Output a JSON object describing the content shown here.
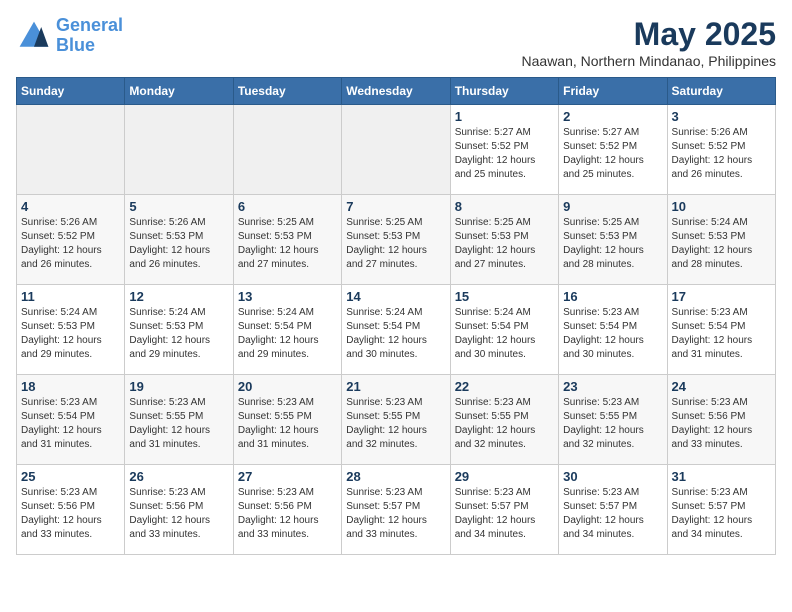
{
  "header": {
    "logo_line1": "General",
    "logo_line2": "Blue",
    "title": "May 2025",
    "subtitle": "Naawan, Northern Mindanao, Philippines"
  },
  "weekdays": [
    "Sunday",
    "Monday",
    "Tuesday",
    "Wednesday",
    "Thursday",
    "Friday",
    "Saturday"
  ],
  "weeks": [
    [
      {
        "day": "",
        "info": ""
      },
      {
        "day": "",
        "info": ""
      },
      {
        "day": "",
        "info": ""
      },
      {
        "day": "",
        "info": ""
      },
      {
        "day": "1",
        "info": "Sunrise: 5:27 AM\nSunset: 5:52 PM\nDaylight: 12 hours\nand 25 minutes."
      },
      {
        "day": "2",
        "info": "Sunrise: 5:27 AM\nSunset: 5:52 PM\nDaylight: 12 hours\nand 25 minutes."
      },
      {
        "day": "3",
        "info": "Sunrise: 5:26 AM\nSunset: 5:52 PM\nDaylight: 12 hours\nand 26 minutes."
      }
    ],
    [
      {
        "day": "4",
        "info": "Sunrise: 5:26 AM\nSunset: 5:52 PM\nDaylight: 12 hours\nand 26 minutes."
      },
      {
        "day": "5",
        "info": "Sunrise: 5:26 AM\nSunset: 5:53 PM\nDaylight: 12 hours\nand 26 minutes."
      },
      {
        "day": "6",
        "info": "Sunrise: 5:25 AM\nSunset: 5:53 PM\nDaylight: 12 hours\nand 27 minutes."
      },
      {
        "day": "7",
        "info": "Sunrise: 5:25 AM\nSunset: 5:53 PM\nDaylight: 12 hours\nand 27 minutes."
      },
      {
        "day": "8",
        "info": "Sunrise: 5:25 AM\nSunset: 5:53 PM\nDaylight: 12 hours\nand 27 minutes."
      },
      {
        "day": "9",
        "info": "Sunrise: 5:25 AM\nSunset: 5:53 PM\nDaylight: 12 hours\nand 28 minutes."
      },
      {
        "day": "10",
        "info": "Sunrise: 5:24 AM\nSunset: 5:53 PM\nDaylight: 12 hours\nand 28 minutes."
      }
    ],
    [
      {
        "day": "11",
        "info": "Sunrise: 5:24 AM\nSunset: 5:53 PM\nDaylight: 12 hours\nand 29 minutes."
      },
      {
        "day": "12",
        "info": "Sunrise: 5:24 AM\nSunset: 5:53 PM\nDaylight: 12 hours\nand 29 minutes."
      },
      {
        "day": "13",
        "info": "Sunrise: 5:24 AM\nSunset: 5:54 PM\nDaylight: 12 hours\nand 29 minutes."
      },
      {
        "day": "14",
        "info": "Sunrise: 5:24 AM\nSunset: 5:54 PM\nDaylight: 12 hours\nand 30 minutes."
      },
      {
        "day": "15",
        "info": "Sunrise: 5:24 AM\nSunset: 5:54 PM\nDaylight: 12 hours\nand 30 minutes."
      },
      {
        "day": "16",
        "info": "Sunrise: 5:23 AM\nSunset: 5:54 PM\nDaylight: 12 hours\nand 30 minutes."
      },
      {
        "day": "17",
        "info": "Sunrise: 5:23 AM\nSunset: 5:54 PM\nDaylight: 12 hours\nand 31 minutes."
      }
    ],
    [
      {
        "day": "18",
        "info": "Sunrise: 5:23 AM\nSunset: 5:54 PM\nDaylight: 12 hours\nand 31 minutes."
      },
      {
        "day": "19",
        "info": "Sunrise: 5:23 AM\nSunset: 5:55 PM\nDaylight: 12 hours\nand 31 minutes."
      },
      {
        "day": "20",
        "info": "Sunrise: 5:23 AM\nSunset: 5:55 PM\nDaylight: 12 hours\nand 31 minutes."
      },
      {
        "day": "21",
        "info": "Sunrise: 5:23 AM\nSunset: 5:55 PM\nDaylight: 12 hours\nand 32 minutes."
      },
      {
        "day": "22",
        "info": "Sunrise: 5:23 AM\nSunset: 5:55 PM\nDaylight: 12 hours\nand 32 minutes."
      },
      {
        "day": "23",
        "info": "Sunrise: 5:23 AM\nSunset: 5:55 PM\nDaylight: 12 hours\nand 32 minutes."
      },
      {
        "day": "24",
        "info": "Sunrise: 5:23 AM\nSunset: 5:56 PM\nDaylight: 12 hours\nand 33 minutes."
      }
    ],
    [
      {
        "day": "25",
        "info": "Sunrise: 5:23 AM\nSunset: 5:56 PM\nDaylight: 12 hours\nand 33 minutes."
      },
      {
        "day": "26",
        "info": "Sunrise: 5:23 AM\nSunset: 5:56 PM\nDaylight: 12 hours\nand 33 minutes."
      },
      {
        "day": "27",
        "info": "Sunrise: 5:23 AM\nSunset: 5:56 PM\nDaylight: 12 hours\nand 33 minutes."
      },
      {
        "day": "28",
        "info": "Sunrise: 5:23 AM\nSunset: 5:57 PM\nDaylight: 12 hours\nand 33 minutes."
      },
      {
        "day": "29",
        "info": "Sunrise: 5:23 AM\nSunset: 5:57 PM\nDaylight: 12 hours\nand 34 minutes."
      },
      {
        "day": "30",
        "info": "Sunrise: 5:23 AM\nSunset: 5:57 PM\nDaylight: 12 hours\nand 34 minutes."
      },
      {
        "day": "31",
        "info": "Sunrise: 5:23 AM\nSunset: 5:57 PM\nDaylight: 12 hours\nand 34 minutes."
      }
    ]
  ]
}
